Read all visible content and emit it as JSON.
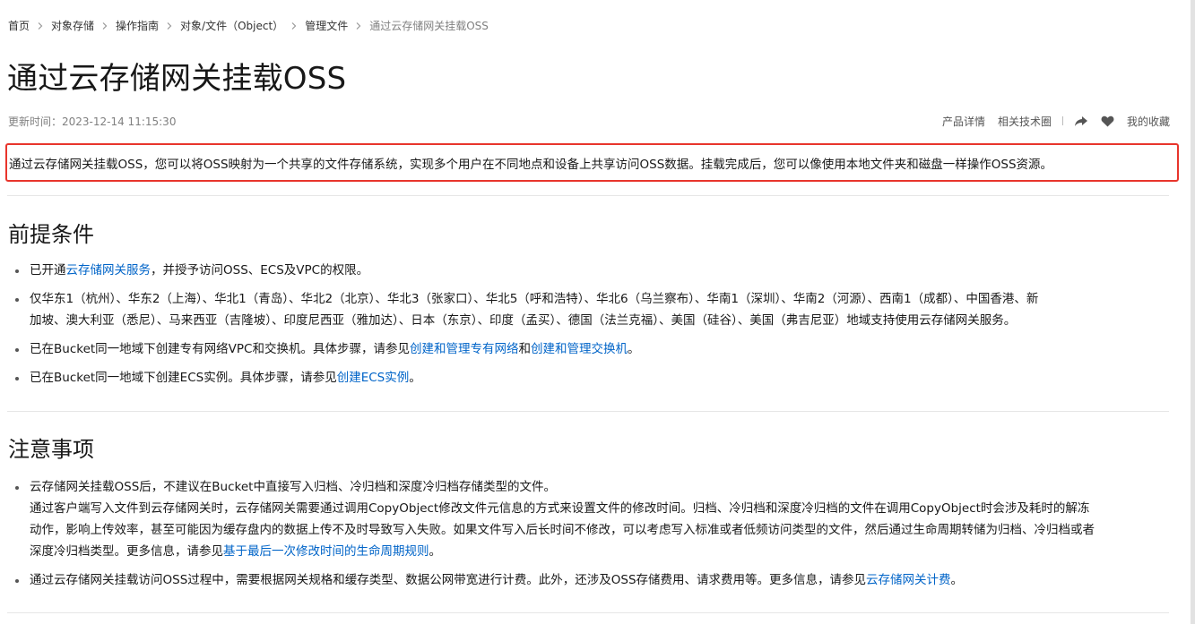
{
  "breadcrumb": {
    "items": [
      "首页",
      "对象存储",
      "操作指南",
      "对象/文件（Object）",
      "管理文件",
      "通过云存储网关挂载OSS"
    ]
  },
  "page": {
    "title": "通过云存储网关挂载OSS",
    "update_time": "更新时间：2023-12-14 11:15:30"
  },
  "actions": {
    "product_details": "产品详情",
    "related_tech": "相关技术圈",
    "favorite": "我的收藏",
    "share_icon": "share-icon",
    "heart_icon": "heart-icon"
  },
  "summary": "通过云存储网关挂载OSS，您可以将OSS映射为一个共享的文件存储系统，实现多个用户在不同地点和设备上共享访问OSS数据。挂载完成后，您可以像使用本地文件夹和磁盘一样操作OSS资源。",
  "prerequisites": {
    "title": "前提条件",
    "items": [
      {
        "pre": "已开通",
        "link": "云存储网关服务",
        "post": "，并授予访问OSS、ECS及VPC的权限。"
      },
      {
        "line1": "仅华东1（杭州）、华东2（上海）、华北1（青岛）、华北2（北京）、华北3（张家口）、华北5（呼和浩特）、华北6（乌兰察布）、华南1（深圳）、华南2（河源）、西南1（成都）、中国香港、新",
        "line2": "加坡、澳大利亚（悉尼）、马来西亚（吉隆坡）、印度尼西亚（雅加达）、日本（东京）、印度（孟买）、德国（法兰克福）、美国（硅谷）、美国（弗吉尼亚）地域支持使用云存储网关服务。"
      },
      {
        "pre": "已在Bucket同一地域下创建专有网络VPC和交换机。具体步骤，请参见",
        "link1": "创建和管理专有网络",
        "mid": "和",
        "link2": "创建和管理交换机",
        "post": "。"
      },
      {
        "pre": "已在Bucket同一地域下创建ECS实例。具体步骤，请参见",
        "link": "创建ECS实例",
        "post": "。"
      }
    ]
  },
  "notes": {
    "title": "注意事项",
    "items": [
      {
        "line1": "云存储网关挂载OSS后，不建议在Bucket中直接写入归档、冷归档和深度冷归档存储类型的文件。",
        "line2": "通过客户端写入文件到云存储网关时，云存储网关需要通过调用CopyObject修改文件元信息的方式来设置文件的修改时间。归档、冷归档和深度冷归档的文件在调用CopyObject时会涉及耗时的解冻",
        "line3": "动作，影响上传效率，甚至可能因为缓存盘内的数据上传不及时导致写入失败。如果文件写入后长时间不修改，可以考虑写入标准或者低频访问类型的文件，然后通过生命周期转储为归档、冷归档或者",
        "line4_pre": "深度冷归档类型。更多信息，请参见",
        "line4_link": "基于最后一次修改时间的生命周期规则",
        "line4_post": "。"
      },
      {
        "pre": "通过云存储网关挂载访问OSS过程中，需要根据网关规格和缓存类型、数据公网带宽进行计费。此外，还涉及OSS存储费用、请求费用等。更多信息，请参见",
        "link": "云存储网关计费",
        "post": "。"
      }
    ]
  },
  "colors": {
    "link": "#0064c8",
    "highlight_border": "#e8352c",
    "text": "#181818",
    "muted": "#808080"
  }
}
